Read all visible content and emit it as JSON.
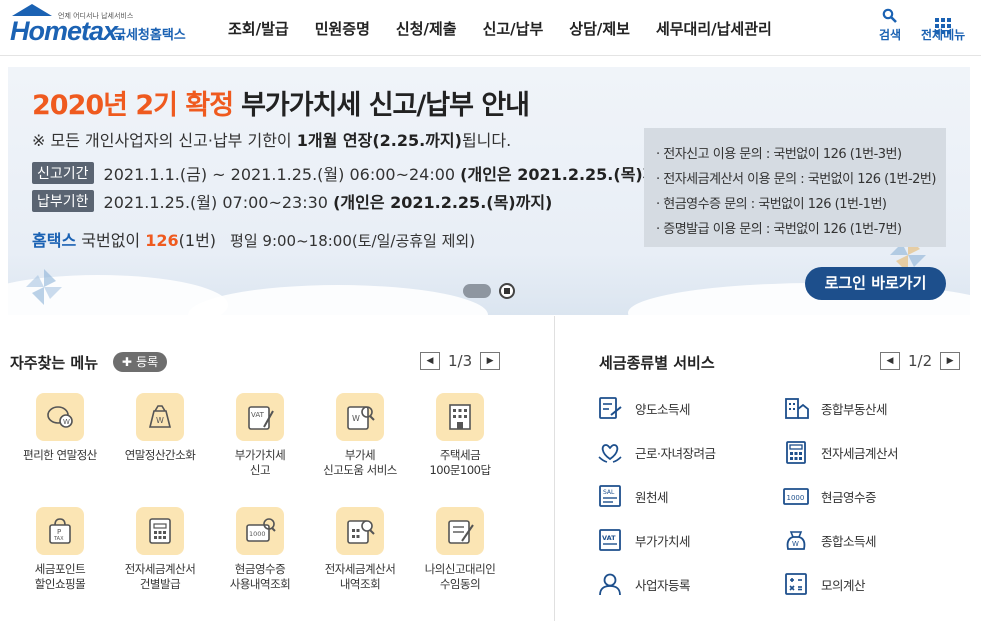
{
  "header": {
    "logo_small": "언제 어디서나 납세서비스",
    "logo_main": "Hometax.",
    "logo_sub": "국세청홈택스",
    "nav": [
      "조회/발급",
      "민원증명",
      "신청/제출",
      "신고/납부",
      "상담/제보",
      "세무대리/납세관리"
    ],
    "search_label": "검색",
    "menu_label": "전체메뉴"
  },
  "banner": {
    "title_orange": "2020년 2기 확정",
    "title_dark": "부가가치세 신고/납부 안내",
    "notice_pre": "※ 모든 개인사업자의 신고·납부 기한이 ",
    "notice_bold": "1개월 연장(2.25.까지)",
    "notice_post": "됩니다.",
    "report_tag": "신고기간",
    "report_text": "2021.1.1.(금) ~ 2021.1.25.(월) 06:00~24:00 ",
    "report_bold": "(개인은 2021.2.25.(목)까지)",
    "pay_tag": "납부기한",
    "pay_text": "2021.1.25.(월) 07:00~23:30 ",
    "pay_bold": "(개인은 2021.2.25.(목)까지)",
    "tel_hometax": "홈택스",
    "tel_pre": " 국번없이 ",
    "tel_num": "126",
    "tel_post": "(1번)",
    "hours": "평일 9:00~18:00(토/일/공휴일 제외)",
    "info": [
      "· 전자신고 이용 문의 : 국번없이 126 (1번-3번)",
      "· 전자세금계산서 이용 문의 : 국번없이 126 (1번-2번)",
      "· 현금영수증 문의 : 국번없이 126 (1번-1번)",
      "· 증명발급 이용 문의 : 국번없이 126 (1번-7번)"
    ],
    "login_button": "로그인 바로가기"
  },
  "favorites": {
    "title": "자주찾는 메뉴",
    "register_button": "등록",
    "pager": "1/3",
    "items": [
      {
        "label": "편리한 연말정산",
        "icon": "settlement-icon"
      },
      {
        "label": "연말정산간소화",
        "icon": "money-bag-icon"
      },
      {
        "label": "부가가치세\n신고",
        "icon": "vat-report-icon"
      },
      {
        "label": "부가세\n신고도움 서비스",
        "icon": "vat-help-icon"
      },
      {
        "label": "주택세금\n100문100답",
        "icon": "building-icon"
      },
      {
        "label": "세금포인트\n할인쇼핑몰",
        "icon": "shopping-bag-icon"
      },
      {
        "label": "전자세금계산서\n건별발급",
        "icon": "invoice-icon"
      },
      {
        "label": "현금영수증\n사용내역조회",
        "icon": "cash-receipt-icon"
      },
      {
        "label": "전자세금계산서\n내역조회",
        "icon": "invoice-search-icon"
      },
      {
        "label": "나의신고대리인\n수임동의",
        "icon": "agent-icon"
      }
    ]
  },
  "tax_services": {
    "title": "세금종류별 서비스",
    "pager": "1/2",
    "items": [
      {
        "label": "양도소득세",
        "icon": "transfer-icon"
      },
      {
        "label": "종합부동산세",
        "icon": "realestate-icon"
      },
      {
        "label": "근로·자녀장려금",
        "icon": "heart-hands-icon"
      },
      {
        "label": "전자세금계산서",
        "icon": "calculator-icon"
      },
      {
        "label": "원천세",
        "icon": "salary-icon"
      },
      {
        "label": "현금영수증",
        "icon": "receipt-1000-icon"
      },
      {
        "label": "부가가치세",
        "icon": "vat-icon"
      },
      {
        "label": "종합소득세",
        "icon": "income-bag-icon"
      },
      {
        "label": "사업자등록",
        "icon": "person-icon"
      },
      {
        "label": "모의계산",
        "icon": "simulation-icon"
      }
    ]
  },
  "colors": {
    "brand": "#1b62b3",
    "accent": "#ef5a1f",
    "icon_bg": "#fbe5b4",
    "login_bg": "#1d4f8c"
  }
}
